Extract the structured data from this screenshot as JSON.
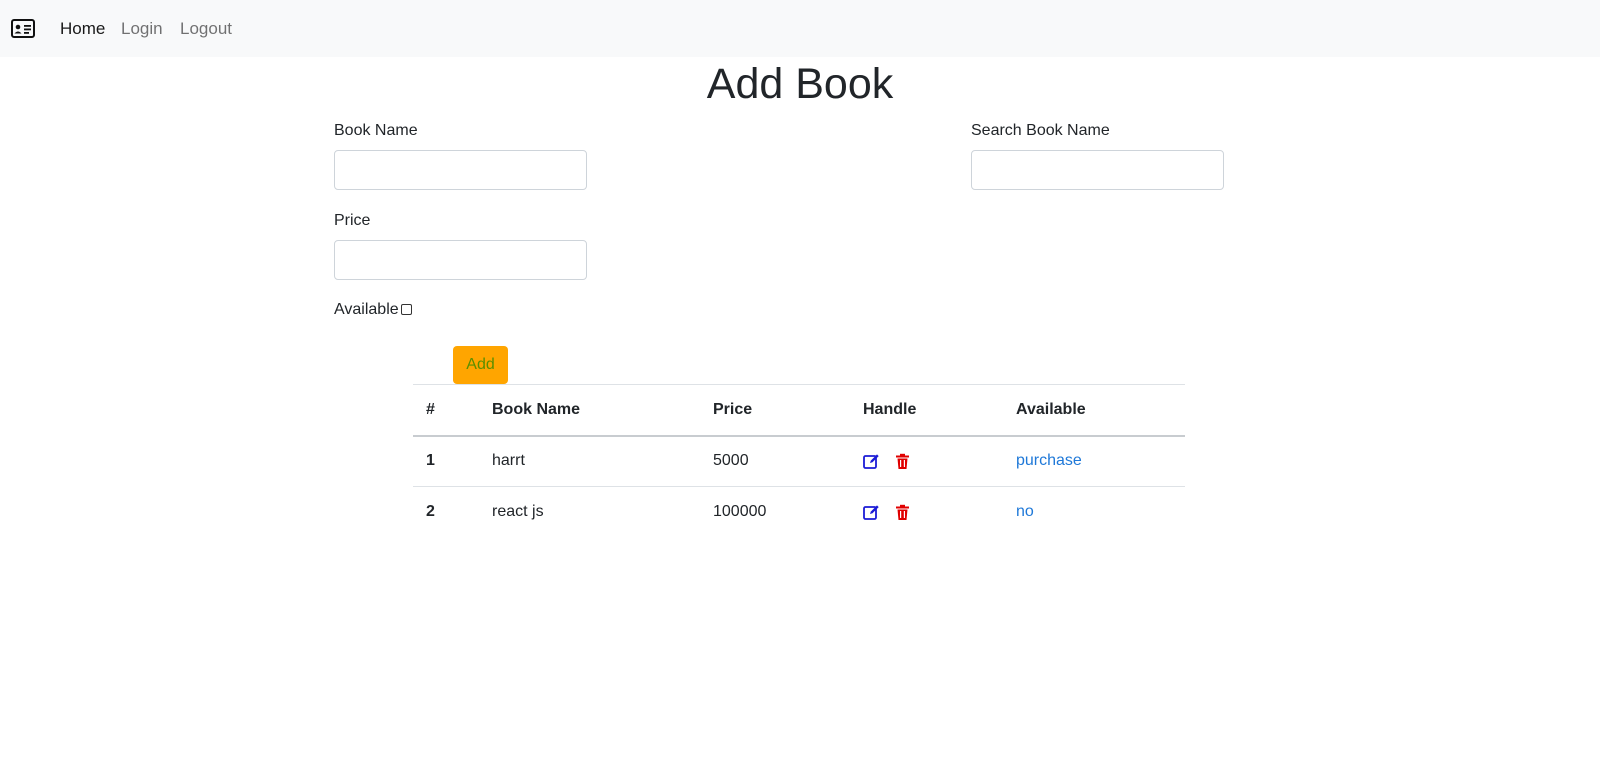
{
  "nav": {
    "brand_icon": "id-card-icon",
    "links": [
      {
        "label": "Home",
        "active": true
      },
      {
        "label": "Login",
        "active": false
      },
      {
        "label": "Logout",
        "active": false
      }
    ]
  },
  "page": {
    "title": "Add Book"
  },
  "form": {
    "book_name_label": "Book Name",
    "book_name_value": "",
    "price_label": "Price",
    "price_value": "",
    "available_label": "Available",
    "available_checked": false,
    "add_label": "Add"
  },
  "search": {
    "label": "Search Book Name",
    "value": ""
  },
  "table": {
    "headers": [
      "#",
      "Book Name",
      "Price",
      "Handle",
      "Available"
    ],
    "rows": [
      {
        "num": "1",
        "name": "harrt",
        "price": "5000",
        "available": "purchase"
      },
      {
        "num": "2",
        "name": "react js",
        "price": "100000",
        "available": "no"
      }
    ]
  },
  "colors": {
    "navbar_bg": "#f8f9fa",
    "add_button_bg": "#ffa500",
    "add_button_text": "#5a8f00",
    "edit_icon": "#1b1bd6",
    "delete_icon": "#e00000",
    "link": "#1e78d8"
  }
}
